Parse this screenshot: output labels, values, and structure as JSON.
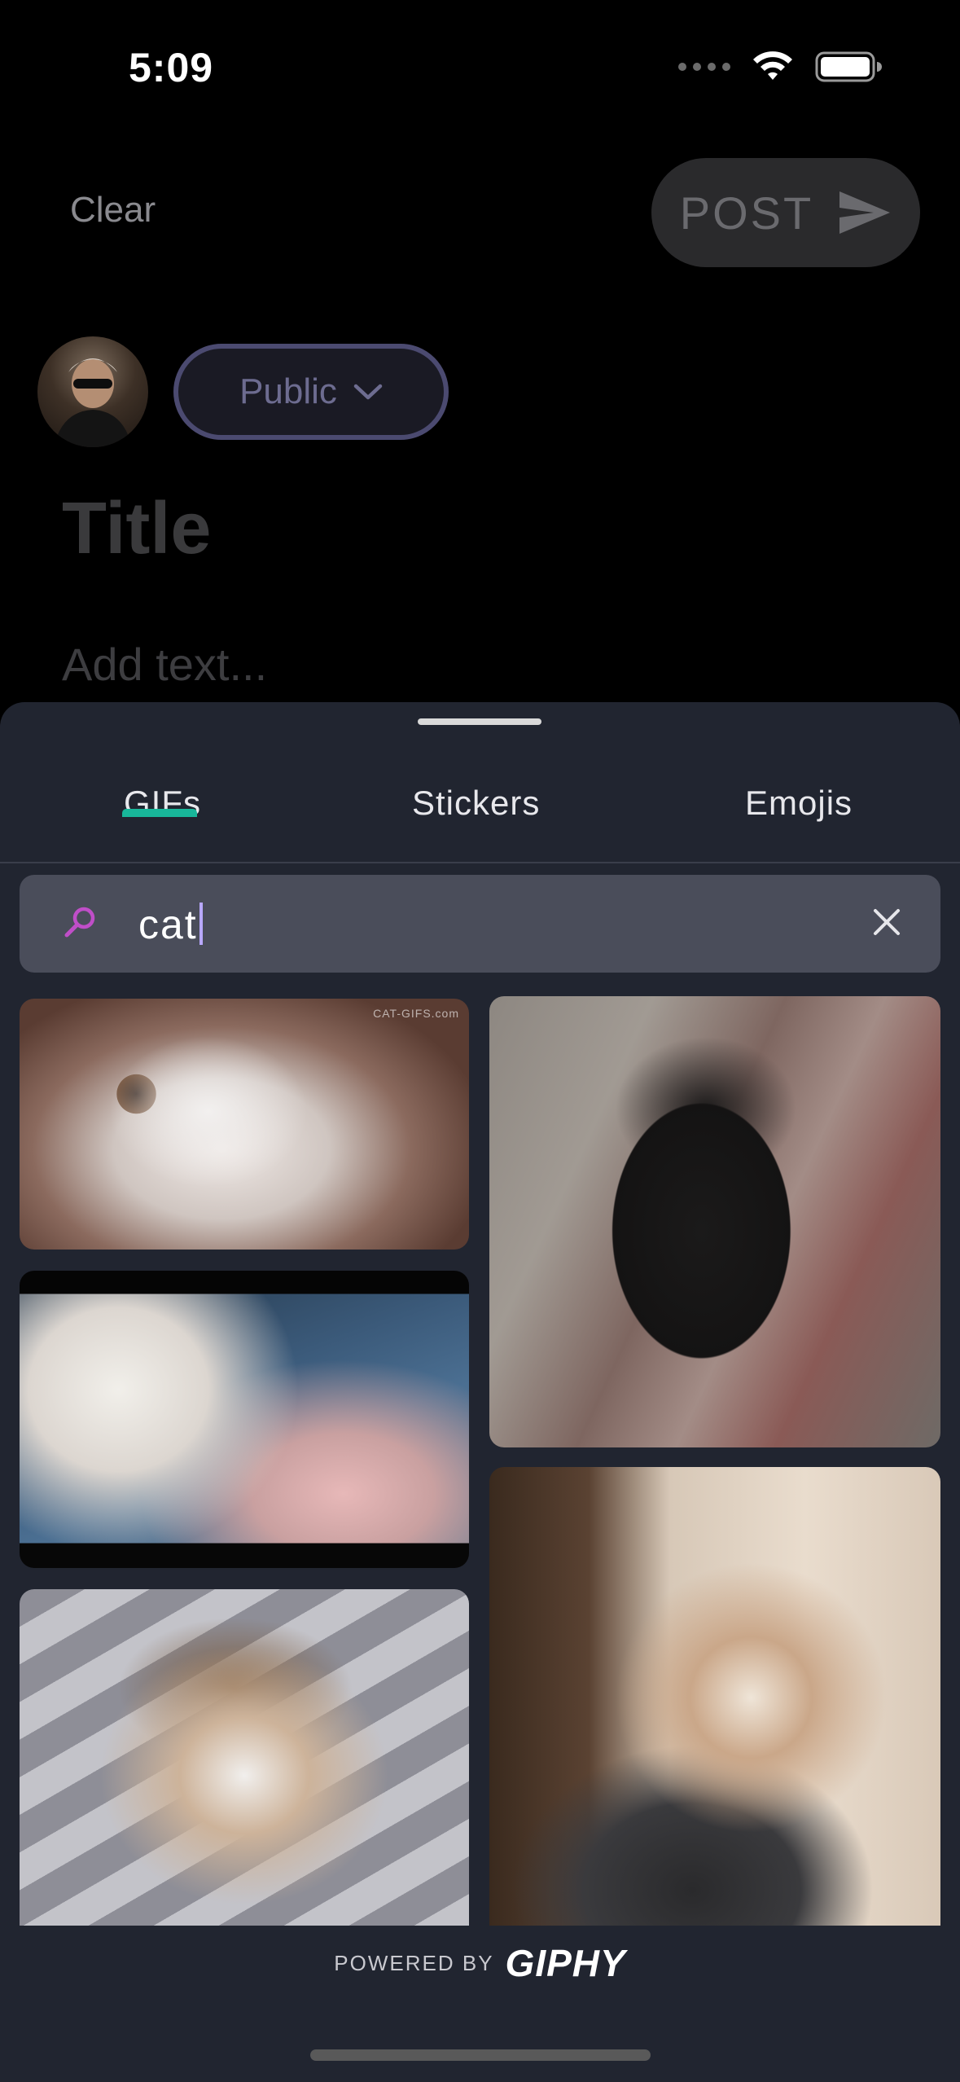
{
  "status_bar": {
    "time": "5:09",
    "icons": [
      "signal-icon",
      "wifi-icon",
      "battery-icon"
    ]
  },
  "composer": {
    "clear_label": "Clear",
    "post_label": "POST",
    "privacy_label": "Public",
    "title_placeholder": "Title",
    "body_placeholder": "Add text..."
  },
  "picker": {
    "tabs": [
      {
        "label": "GIFs",
        "selected": true
      },
      {
        "label": "Stickers",
        "selected": false
      },
      {
        "label": "Emojis",
        "selected": false
      }
    ],
    "search": {
      "value": "cat"
    },
    "results": [
      {
        "name": "kitten-closeup",
        "caption": "CAT-GIFS.com"
      },
      {
        "name": "black-cat-nail-file"
      },
      {
        "name": "white-cat-vibing"
      },
      {
        "name": "cat-with-glasses-laptop"
      },
      {
        "name": "calico-cat-pouting"
      }
    ],
    "attribution": {
      "prefix": "POWERED BY",
      "brand": "GIPHY"
    }
  },
  "colors": {
    "accent": "#18b79a",
    "search_icon": "#c04ec8",
    "sheet_bg": "#212530"
  }
}
